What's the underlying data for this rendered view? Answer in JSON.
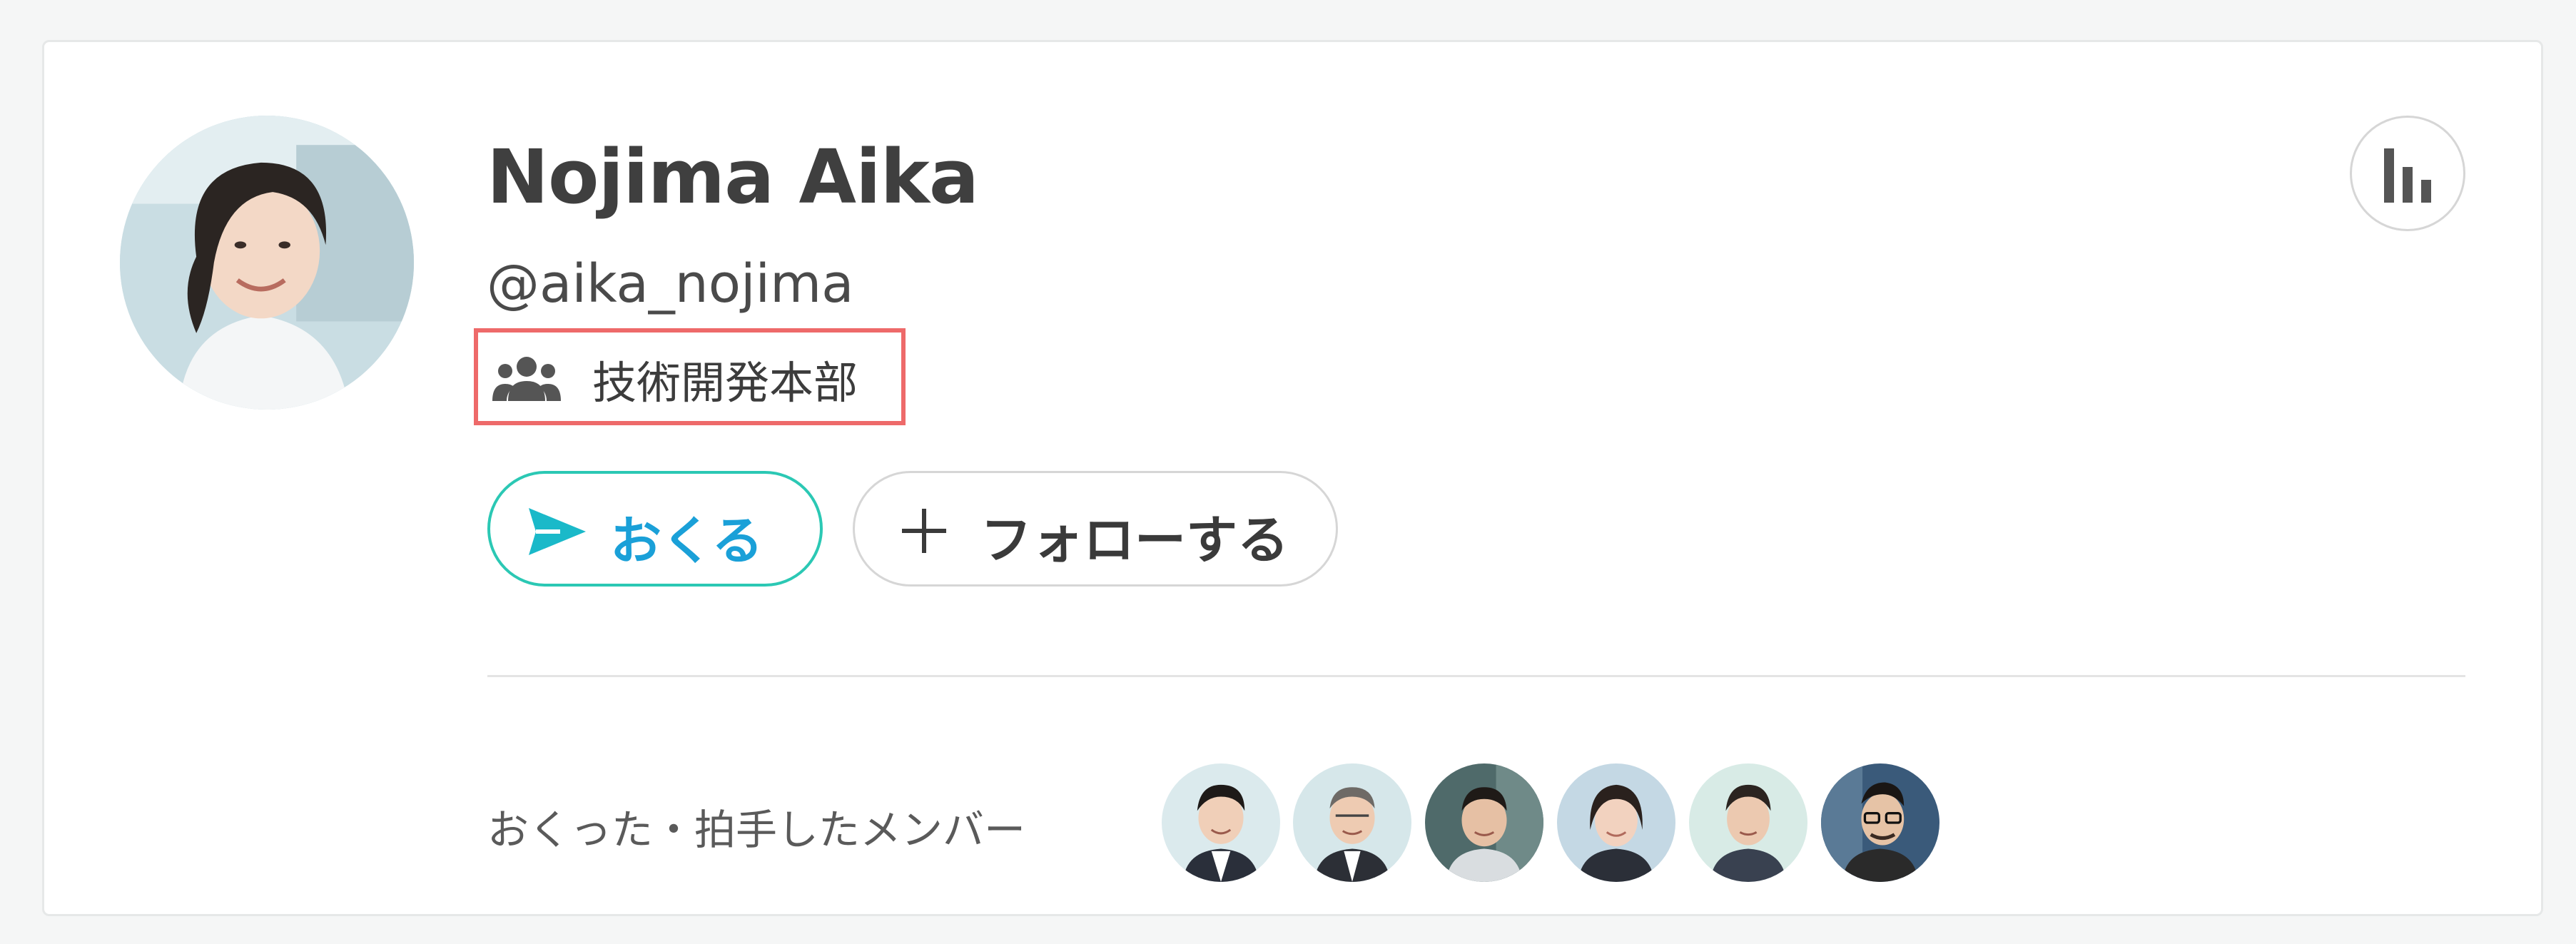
{
  "profile": {
    "name": "Nojima Aika",
    "handle": "@aika_nojima",
    "department": "技術開発本部",
    "avatar_icon": "user-avatar-photo",
    "department_icon": "users-group-icon"
  },
  "actions": {
    "send_label": "おくる",
    "send_icon": "paper-plane-icon",
    "follow_label": "フォローする",
    "follow_icon": "plus-icon",
    "stats_icon": "bar-chart-icon"
  },
  "members": {
    "label": "おくった・拍手したメンバー",
    "avatars": [
      {
        "icon": "member-avatar-photo"
      },
      {
        "icon": "member-avatar-photo"
      },
      {
        "icon": "member-avatar-photo"
      },
      {
        "icon": "member-avatar-photo"
      },
      {
        "icon": "member-avatar-photo"
      },
      {
        "icon": "member-avatar-photo"
      }
    ]
  },
  "colors": {
    "send_accent": "#1aa0d8",
    "send_border": "#2bc8b4",
    "highlight_border": "#ee6a6a"
  }
}
